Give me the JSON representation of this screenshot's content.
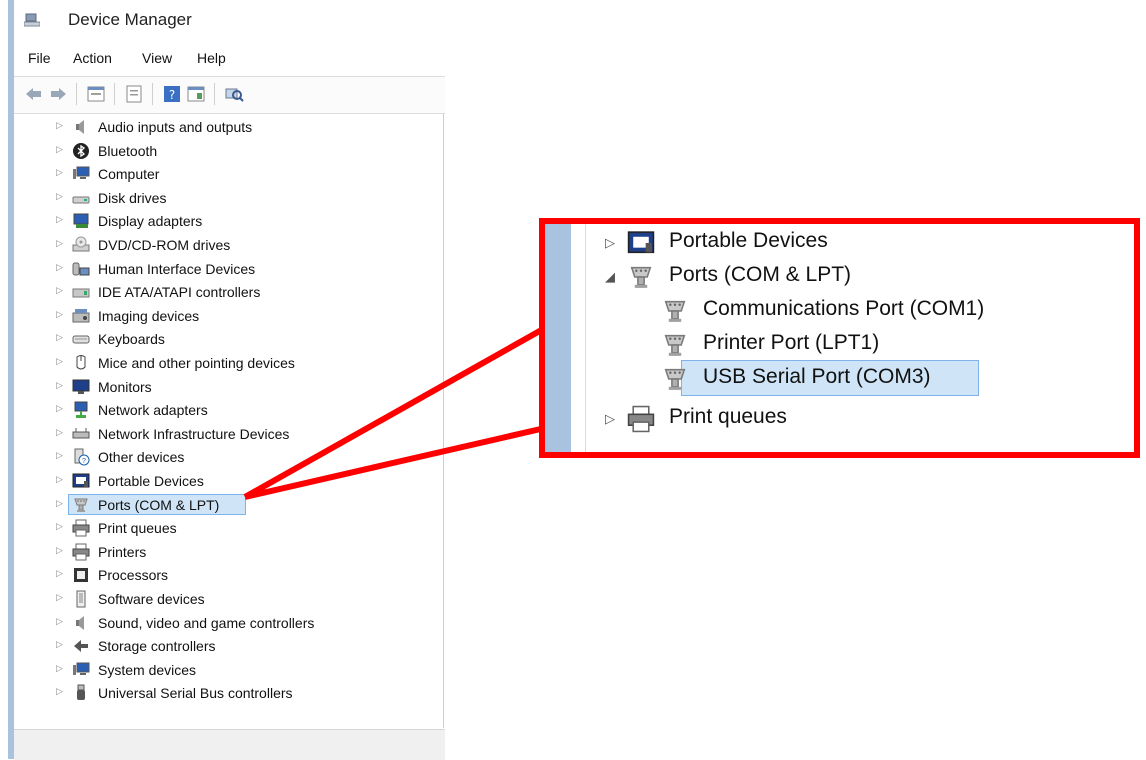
{
  "window": {
    "title": "Device Manager"
  },
  "menu": [
    "File",
    "Action",
    "View",
    "Help"
  ],
  "toolbar": [
    "back-icon",
    "forward-icon",
    "properties-icon",
    "update-driver-icon",
    "help-icon",
    "show-hidden-icon",
    "scan-hardware-icon"
  ],
  "tree": {
    "items": [
      {
        "label": "Audio inputs and outputs",
        "icon": "speaker-icon"
      },
      {
        "label": "Bluetooth",
        "icon": "bluetooth-icon"
      },
      {
        "label": "Computer",
        "icon": "computer-icon"
      },
      {
        "label": "Disk drives",
        "icon": "disk-drive-icon"
      },
      {
        "label": "Display adapters",
        "icon": "display-adapter-icon"
      },
      {
        "label": "DVD/CD-ROM drives",
        "icon": "dvd-drive-icon"
      },
      {
        "label": "Human Interface Devices",
        "icon": "hid-icon"
      },
      {
        "label": "IDE ATA/ATAPI controllers",
        "icon": "ide-controller-icon"
      },
      {
        "label": "Imaging devices",
        "icon": "imaging-device-icon"
      },
      {
        "label": "Keyboards",
        "icon": "keyboard-icon"
      },
      {
        "label": "Mice and other pointing devices",
        "icon": "mouse-icon"
      },
      {
        "label": "Monitors",
        "icon": "monitor-icon"
      },
      {
        "label": "Network adapters",
        "icon": "network-adapter-icon"
      },
      {
        "label": "Network Infrastructure Devices",
        "icon": "network-infrastructure-icon"
      },
      {
        "label": "Other devices",
        "icon": "other-devices-icon"
      },
      {
        "label": "Portable Devices",
        "icon": "portable-device-icon"
      },
      {
        "label": "Ports (COM & LPT)",
        "icon": "port-icon",
        "selected": true
      },
      {
        "label": "Print queues",
        "icon": "printer-icon"
      },
      {
        "label": "Printers",
        "icon": "printer-icon"
      },
      {
        "label": "Processors",
        "icon": "processor-icon"
      },
      {
        "label": "Software devices",
        "icon": "software-device-icon"
      },
      {
        "label": "Sound, video and game controllers",
        "icon": "speaker-icon"
      },
      {
        "label": "Storage controllers",
        "icon": "storage-controller-icon"
      },
      {
        "label": "System devices",
        "icon": "system-device-icon"
      },
      {
        "label": "Universal Serial Bus controllers",
        "icon": "usb-icon"
      }
    ]
  },
  "zoom": {
    "items": [
      {
        "label": "Portable Devices",
        "icon": "portable-device-icon",
        "expander": "▷"
      },
      {
        "label": "Ports (COM & LPT)",
        "icon": "port-icon",
        "expander": "◢"
      },
      {
        "label": "Communications Port (COM1)",
        "icon": "port-icon",
        "expander": ""
      },
      {
        "label": "Printer Port (LPT1)",
        "icon": "port-icon",
        "expander": ""
      },
      {
        "label": "USB Serial Port (COM3)",
        "icon": "port-icon",
        "expander": "",
        "selected": true
      },
      {
        "label": "Print queues",
        "icon": "printer-icon",
        "expander": "▷"
      }
    ]
  },
  "colors": {
    "highlight": "#ff0000",
    "selection": "#cfe5f7",
    "selection_border": "#7eb4ea",
    "window_frame": "#a8c2e0"
  }
}
